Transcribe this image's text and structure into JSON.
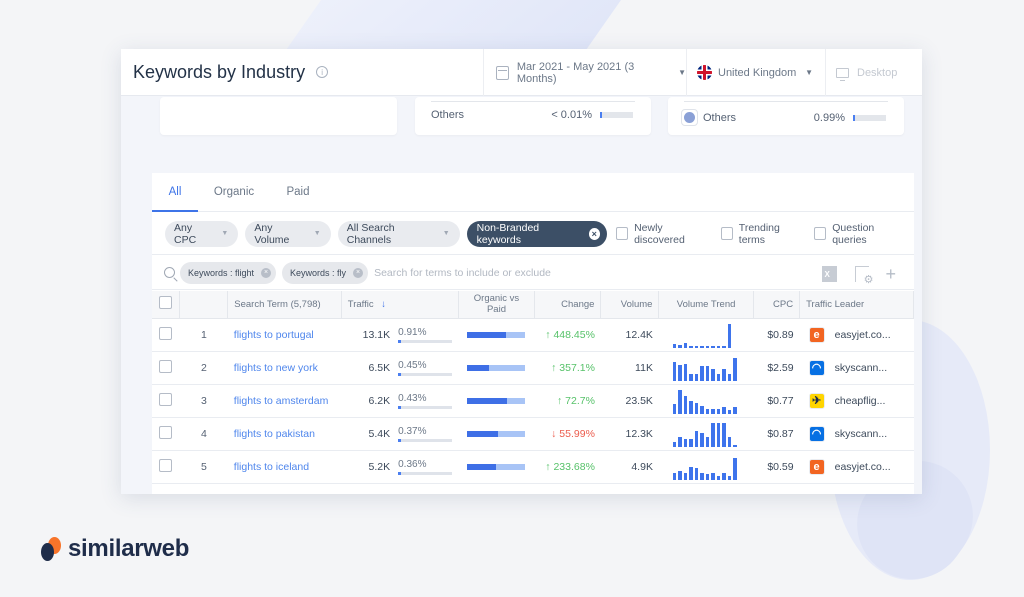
{
  "header": {
    "title": "Keywords by Industry",
    "date_range": "Mar 2021 - May 2021 (3 Months)",
    "country": "United Kingdom",
    "device": "Desktop"
  },
  "summary_cards": [
    {
      "label": "Others",
      "value": "< 0.01%",
      "has_icon": false
    },
    {
      "label": "Others",
      "value": "0.99%",
      "has_icon": true
    }
  ],
  "tabs": [
    {
      "label": "All",
      "active": true
    },
    {
      "label": "Organic",
      "active": false
    },
    {
      "label": "Paid",
      "active": false
    }
  ],
  "filters": {
    "cpc": "Any CPC",
    "volume": "Any Volume",
    "channels": "All Search Channels",
    "branded": "Non-Branded keywords",
    "checkboxes": [
      "Newly discovered",
      "Trending terms",
      "Question queries"
    ]
  },
  "search": {
    "chips": [
      "Keywords : flight",
      "Keywords : fly"
    ],
    "placeholder": "Search for terms to include or exclude"
  },
  "table": {
    "columns": {
      "search_term": "Search Term (5,798)",
      "traffic": "Traffic",
      "organic_vs_paid": "Organic vs Paid",
      "change": "Change",
      "volume": "Volume",
      "volume_trend": "Volume Trend",
      "cpc": "CPC",
      "traffic_leader": "Traffic Leader"
    },
    "rows": [
      {
        "rank": "1",
        "term": "flights to portugal",
        "traffic": "13.1K",
        "share": "0.91%",
        "organic_pct": 67,
        "change": "448.45%",
        "direction": "up",
        "volume": "12.4K",
        "trend": [
          15,
          12,
          22,
          10,
          8,
          10,
          5,
          5,
          8,
          10,
          100
        ],
        "cpc": "$0.89",
        "leader": "easyjet.co...",
        "leader_icon": "easyjet"
      },
      {
        "rank": "2",
        "term": "flights to new york",
        "traffic": "6.5K",
        "share": "0.45%",
        "organic_pct": 37,
        "change": "357.1%",
        "direction": "up",
        "volume": "11K",
        "trend": [
          78,
          65,
          72,
          30,
          30,
          62,
          62,
          50,
          30,
          48,
          30,
          96
        ],
        "cpc": "$2.59",
        "leader": "skyscann...",
        "leader_icon": "skyscanner"
      },
      {
        "rank": "3",
        "term": "flights to amsterdam",
        "traffic": "6.2K",
        "share": "0.43%",
        "organic_pct": 68,
        "change": "72.7%",
        "direction": "up",
        "volume": "23.5K",
        "trend": [
          40,
          100,
          75,
          55,
          45,
          35,
          22,
          22,
          22,
          30,
          15,
          30
        ],
        "cpc": "$0.77",
        "leader": "cheapflig...",
        "leader_icon": "cheapflights"
      },
      {
        "rank": "4",
        "term": "flights to pakistan",
        "traffic": "5.4K",
        "share": "0.37%",
        "organic_pct": 54,
        "change": "55.99%",
        "direction": "down",
        "volume": "12.3K",
        "trend": [
          22,
          40,
          35,
          35,
          65,
          60,
          40,
          100,
          100,
          100,
          40,
          5
        ],
        "cpc": "$0.87",
        "leader": "skyscann...",
        "leader_icon": "skyscanner"
      },
      {
        "rank": "5",
        "term": "flights to iceland",
        "traffic": "5.2K",
        "share": "0.36%",
        "organic_pct": 50,
        "change": "233.68%",
        "direction": "up",
        "volume": "4.9K",
        "trend": [
          28,
          38,
          30,
          55,
          48,
          30,
          25,
          28,
          18,
          30,
          18,
          90
        ],
        "cpc": "$0.59",
        "leader": "easyjet.co...",
        "leader_icon": "easyjet"
      }
    ]
  },
  "brand": {
    "name": "similarweb"
  },
  "colors": {
    "accent": "#3e74e8",
    "up": "#57c26a",
    "down": "#ec5d4e",
    "easyjet": "#f26522",
    "skyscanner": "#0770e3",
    "cheapflights": "#ffd500"
  }
}
